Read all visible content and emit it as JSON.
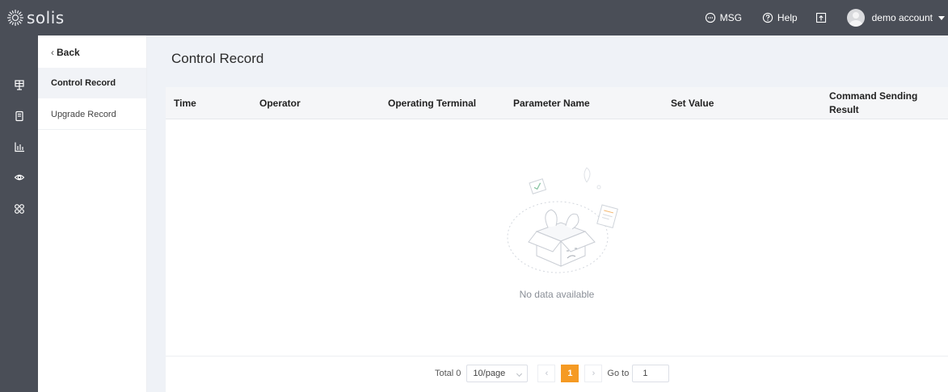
{
  "header": {
    "logo_text": "solis",
    "msg_label": "MSG",
    "help_label": "Help",
    "account_name": "demo account",
    "colors": {
      "bar": "#4a4e57",
      "accent": "#f59a23"
    }
  },
  "rail": {
    "icons": [
      "station-icon",
      "device-icon",
      "analytics-icon",
      "monitor-icon",
      "apps-icon"
    ]
  },
  "sidebar": {
    "back_label": "Back",
    "items": [
      {
        "label": "Control Record",
        "active": true
      },
      {
        "label": "Upgrade Record",
        "active": false
      }
    ]
  },
  "main": {
    "title": "Control Record",
    "table": {
      "columns": [
        "Time",
        "Operator",
        "Operating Terminal",
        "Parameter Name",
        "Set Value",
        "Command Sending Result"
      ],
      "rows": []
    },
    "empty_text": "No data available"
  },
  "pagination": {
    "total_label": "Total 0",
    "page_size": "10/page",
    "current_page": "1",
    "goto_label": "Go to",
    "goto_value": "1"
  }
}
